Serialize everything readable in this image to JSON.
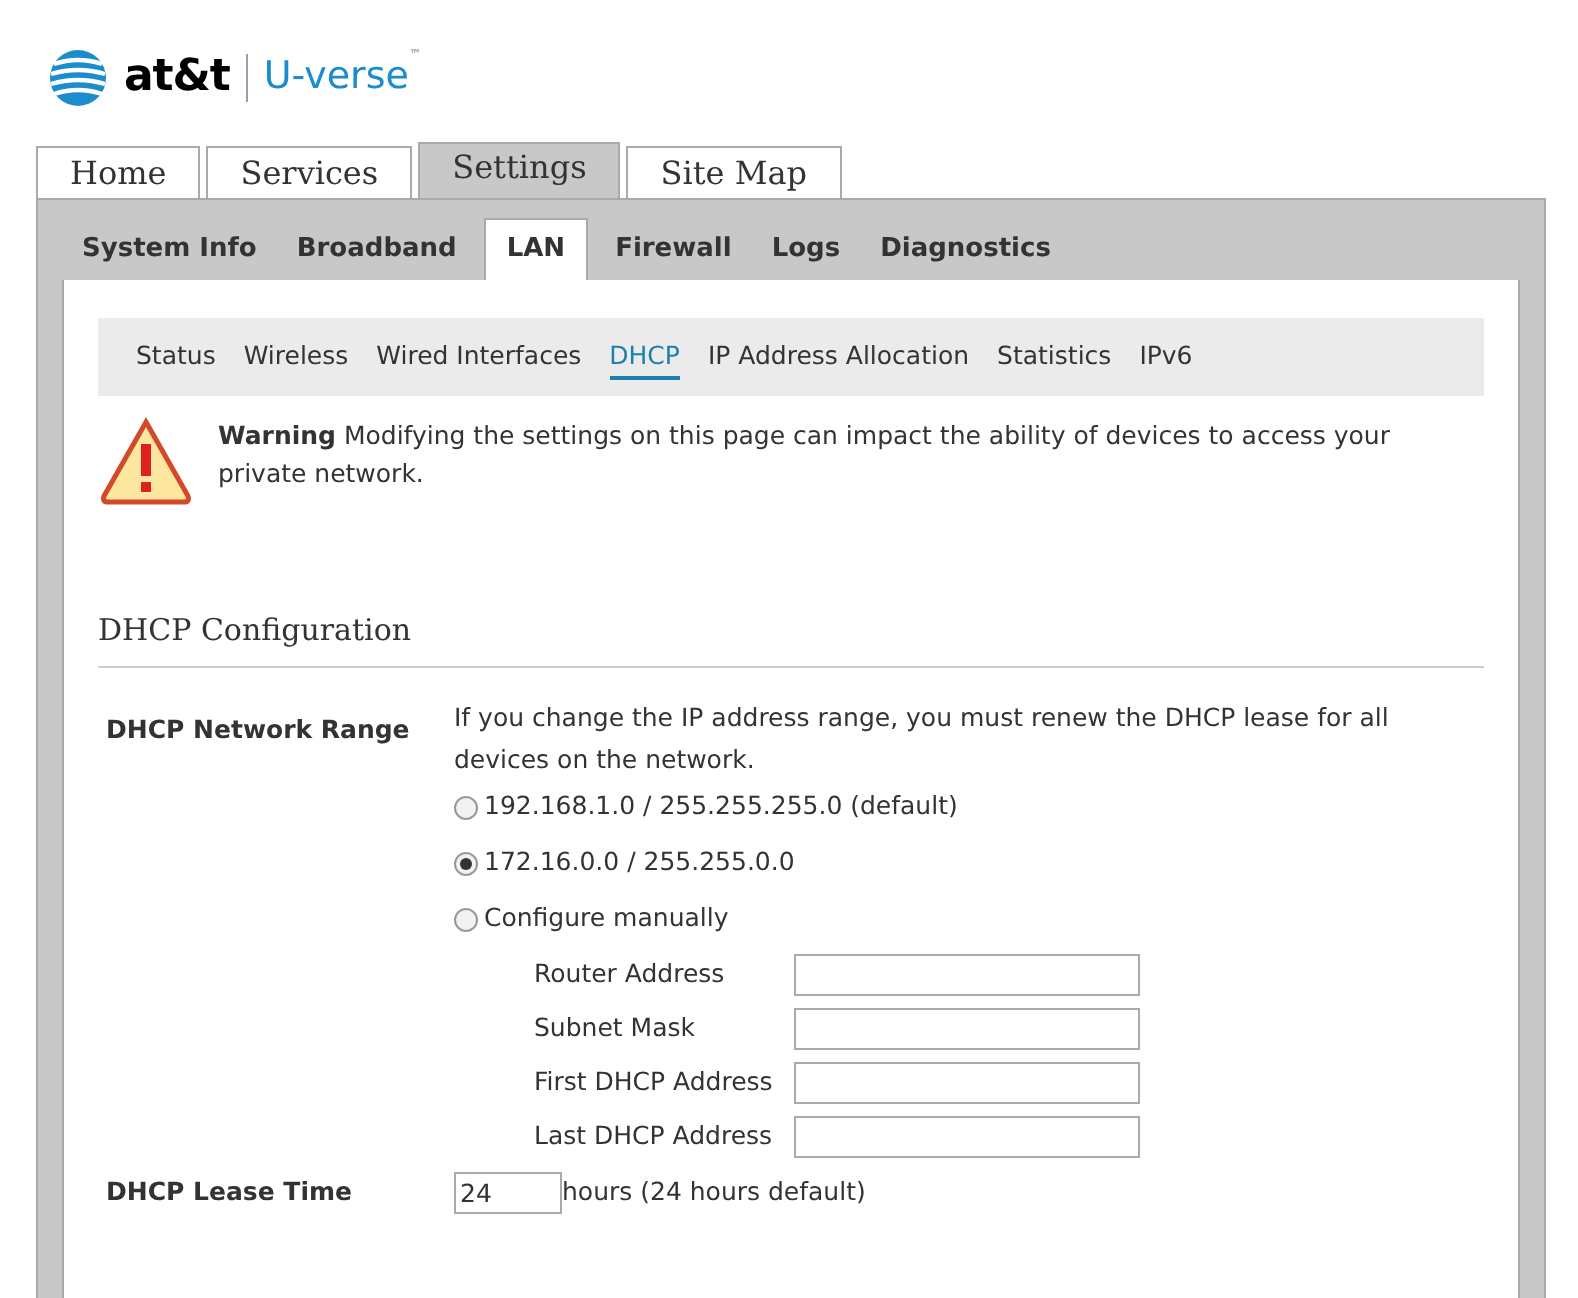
{
  "logo": {
    "brand": "at&t",
    "product": "U-verse",
    "trademark": "™"
  },
  "main_tabs": [
    {
      "label": "Home",
      "selected": false
    },
    {
      "label": "Services",
      "selected": false
    },
    {
      "label": "Settings",
      "selected": true
    },
    {
      "label": "Site Map",
      "selected": false
    }
  ],
  "sub_tabs": [
    {
      "label": "System Info",
      "selected": false
    },
    {
      "label": "Broadband",
      "selected": false
    },
    {
      "label": "LAN",
      "selected": true
    },
    {
      "label": "Firewall",
      "selected": false
    },
    {
      "label": "Logs",
      "selected": false
    },
    {
      "label": "Diagnostics",
      "selected": false
    }
  ],
  "section_nav": [
    {
      "label": "Status",
      "selected": false
    },
    {
      "label": "Wireless",
      "selected": false
    },
    {
      "label": "Wired Interfaces",
      "selected": false
    },
    {
      "label": "DHCP",
      "selected": true
    },
    {
      "label": "IP Address Allocation",
      "selected": false
    },
    {
      "label": "Statistics",
      "selected": false
    },
    {
      "label": "IPv6",
      "selected": false
    }
  ],
  "warning": {
    "text": "**Warning** Modifying the settings on this page can impact the ability of devices to access your private network."
  },
  "section": {
    "title": "DHCP Configuration",
    "network_range": {
      "label": "DHCP Network Range",
      "note": "If you change the IP address range, you must renew the DHCP lease for all devices on the network.",
      "options": [
        {
          "label": "192.168.1.0 / 255.255.255.0 (default)",
          "selected": false
        },
        {
          "label": "172.16.0.0 / 255.255.0.0",
          "selected": true
        },
        {
          "label": "Configure manually",
          "selected": false
        }
      ],
      "manual_fields": [
        {
          "label": "Router Address"
        },
        {
          "label": "Subnet Mask"
        },
        {
          "label": "First DHCP Address"
        },
        {
          "label": "Last DHCP Address"
        }
      ]
    },
    "lease_time": {
      "label": "DHCP Lease Time",
      "value": "24",
      "suffix": "hours (24 hours default)"
    }
  }
}
